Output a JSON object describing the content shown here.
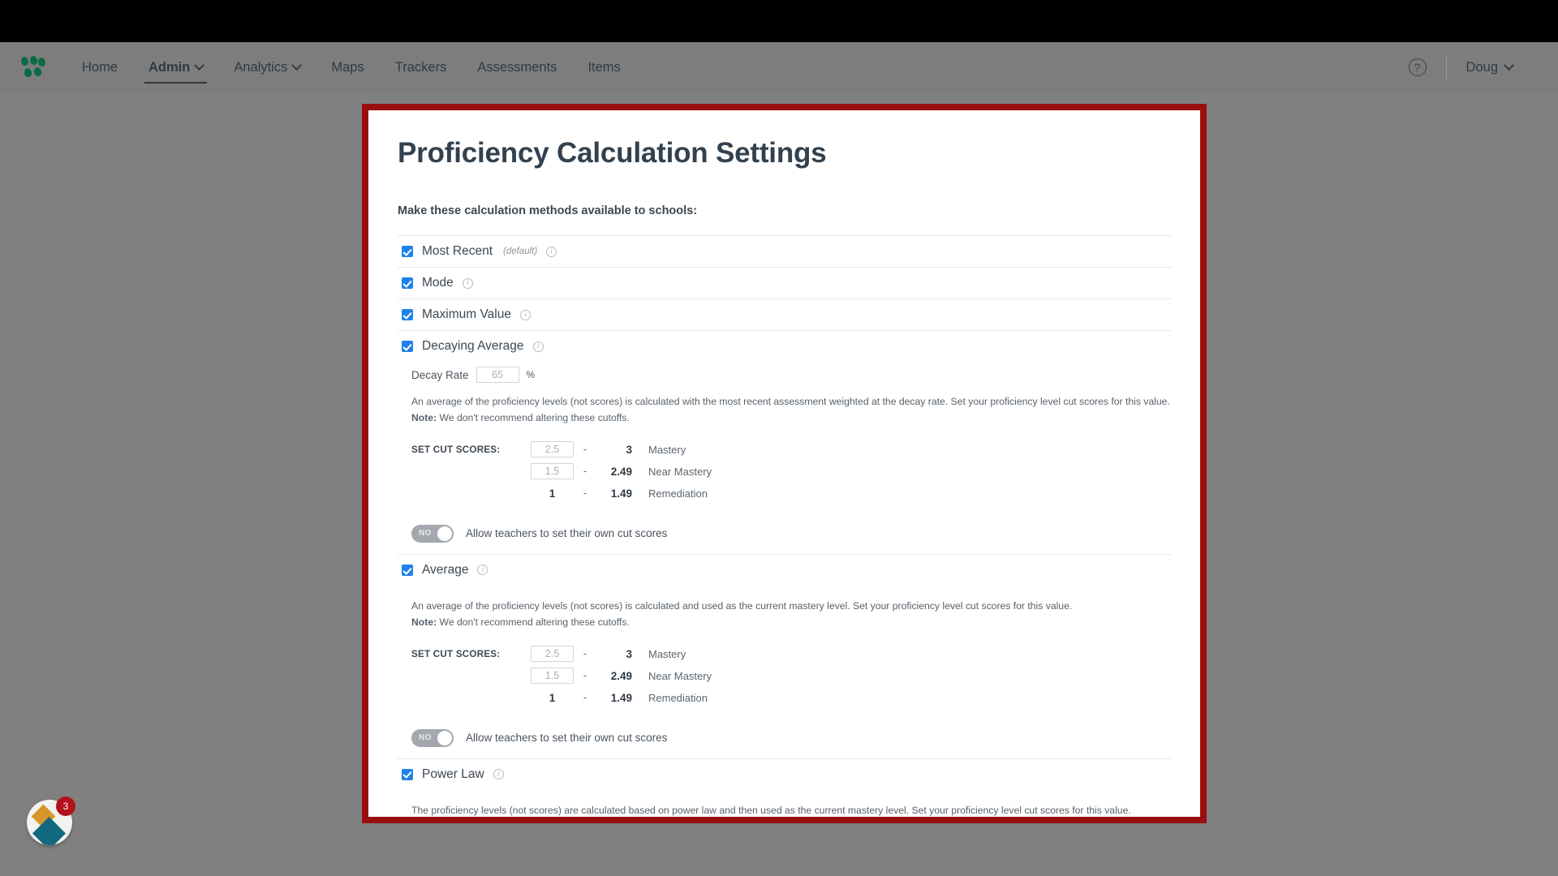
{
  "nav": {
    "logo_name": "mastery-logo",
    "items": [
      {
        "label": "Home",
        "has_caret": false,
        "active": false
      },
      {
        "label": "Admin",
        "has_caret": true,
        "active": true
      },
      {
        "label": "Analytics",
        "has_caret": true,
        "active": false
      },
      {
        "label": "Maps",
        "has_caret": false,
        "active": false
      },
      {
        "label": "Trackers",
        "has_caret": false,
        "active": false
      },
      {
        "label": "Assessments",
        "has_caret": false,
        "active": false
      },
      {
        "label": "Items",
        "has_caret": false,
        "active": false
      }
    ],
    "help_icon": "?",
    "user": "Doug"
  },
  "page": {
    "title": "Proficiency Calculation Settings",
    "section_label": "Make these calculation methods available to schools:"
  },
  "methods": {
    "most_recent": {
      "label": "Most Recent",
      "default_tag": "(default)",
      "checked": true
    },
    "mode": {
      "label": "Mode",
      "checked": true
    },
    "maximum_value": {
      "label": "Maximum Value",
      "checked": true
    },
    "decaying_average": {
      "label": "Decaying Average",
      "checked": true,
      "decay_rate_label": "Decay Rate",
      "decay_rate_value": "65",
      "percent_symbol": "%",
      "description": "An average of the proficiency levels (not scores) is calculated with the most recent assessment weighted at the decay rate. Set your proficiency level cut scores for this value.",
      "note_prefix": "Note:",
      "note_text": " We don't recommend altering these cutoffs.",
      "cut_scores_title": "SET CUT SCORES:",
      "cut_rows": [
        {
          "low": "2.5",
          "low_boxed": true,
          "dash": "-",
          "high": "3",
          "level": "Mastery"
        },
        {
          "low": "1.5",
          "low_boxed": true,
          "dash": "-",
          "high": "2.49",
          "level": "Near Mastery"
        },
        {
          "low": "1",
          "low_boxed": false,
          "dash": "-",
          "high": "1.49",
          "level": "Remediation"
        }
      ],
      "toggle_state": "NO",
      "toggle_label": "Allow teachers to set their own cut scores"
    },
    "average": {
      "label": "Average",
      "checked": true,
      "description": "An average of the proficiency levels (not scores) is calculated and used as the current mastery level. Set your proficiency level cut scores for this value.",
      "note_prefix": "Note:",
      "note_text": " We don't recommend altering these cutoffs.",
      "cut_scores_title": "SET CUT SCORES:",
      "cut_rows": [
        {
          "low": "2.5",
          "low_boxed": true,
          "dash": "-",
          "high": "3",
          "level": "Mastery"
        },
        {
          "low": "1.5",
          "low_boxed": true,
          "dash": "-",
          "high": "2.49",
          "level": "Near Mastery"
        },
        {
          "low": "1",
          "low_boxed": false,
          "dash": "-",
          "high": "1.49",
          "level": "Remediation"
        }
      ],
      "toggle_state": "NO",
      "toggle_label": "Allow teachers to set their own cut scores"
    },
    "power_law": {
      "label": "Power Law",
      "checked": true,
      "description": "The proficiency levels (not scores) are calculated based on power law and then used as the current mastery level. Set your proficiency level cut scores for this value."
    }
  },
  "widget": {
    "badge_count": "3",
    "name": "help-beacon"
  },
  "colors": {
    "accent_blue": "#1f82e8",
    "highlight_red": "#990f0f",
    "title_slate": "#33414f",
    "toggle_gray": "#a2a8ad",
    "logo_green": "#0b6b45",
    "badge_red": "#b2121a",
    "widget_gold": "#d8952a",
    "widget_teal": "#12687e",
    "desktop_gray": "#808080"
  }
}
